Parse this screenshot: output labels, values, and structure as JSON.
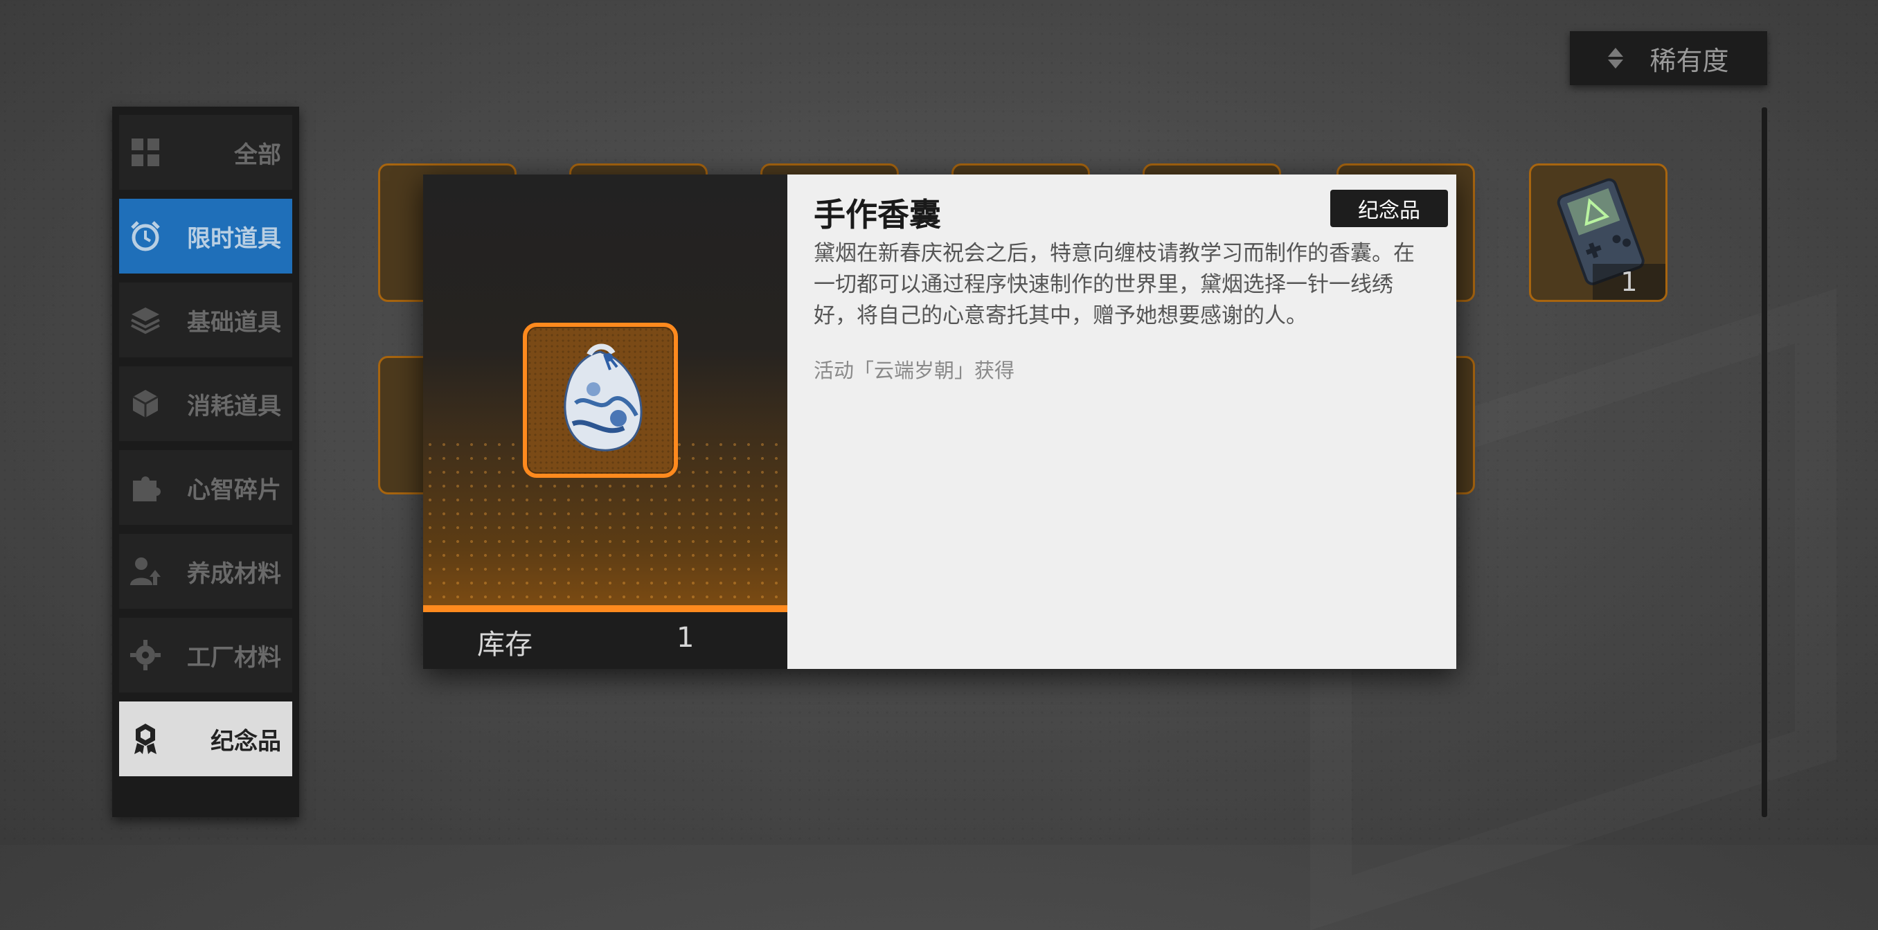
{
  "sort": {
    "label": "稀有度"
  },
  "sidebar": {
    "items": [
      {
        "label": "全部",
        "icon": "grid-icon"
      },
      {
        "label": "限时道具",
        "icon": "alarm-clock-icon"
      },
      {
        "label": "基础道具",
        "icon": "layers-icon"
      },
      {
        "label": "消耗道具",
        "icon": "cube-icon"
      },
      {
        "label": "心智碎片",
        "icon": "puzzle-icon"
      },
      {
        "label": "养成材料",
        "icon": "user-upgrade-icon"
      },
      {
        "label": "工厂材料",
        "icon": "gear-icon"
      },
      {
        "label": "纪念品",
        "icon": "medal-icon"
      }
    ]
  },
  "inventory": {
    "visible_count": "1"
  },
  "item_detail": {
    "title": "手作香囊",
    "badge": "纪念品",
    "description": "黛烟在新春庆祝会之后，特意向缠枝请教学习而制作的香囊。在一切都可以通过程序快速制作的世界里，黛烟选择一针一线绣好，将自己的心意寄托其中，赠予她想要感谢的人。",
    "source": "活动「云端岁朝」获得",
    "stock_label": "库存",
    "stock_value": "1"
  },
  "colors": {
    "accent_orange": "#ff8a1e",
    "active_blue": "#1f6fb9",
    "panel_dark": "#1b1b1b"
  }
}
